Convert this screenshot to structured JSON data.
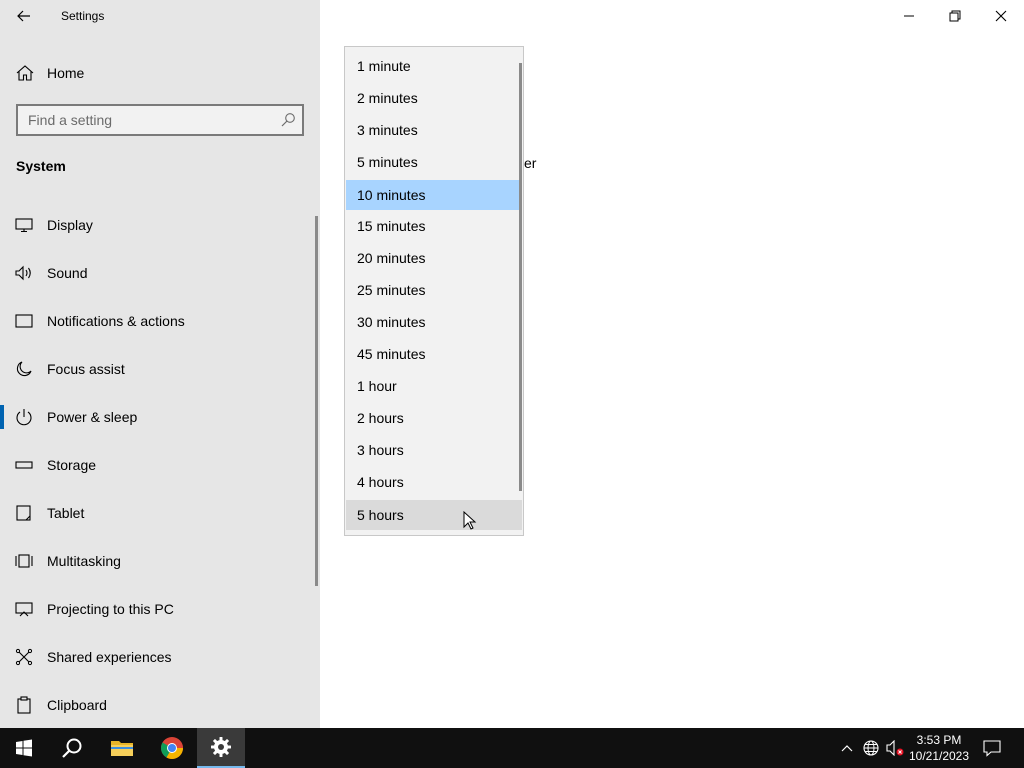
{
  "window": {
    "title": "Settings",
    "back_icon": "back-arrow-icon"
  },
  "sidebar": {
    "home_label": "Home",
    "search_placeholder": "Find a setting",
    "section_title": "System",
    "items": [
      {
        "label": "Display",
        "icon": "display-icon"
      },
      {
        "label": "Sound",
        "icon": "sound-icon"
      },
      {
        "label": "Notifications & actions",
        "icon": "notifications-icon"
      },
      {
        "label": "Focus assist",
        "icon": "focus-assist-icon"
      },
      {
        "label": "Power & sleep",
        "icon": "power-icon",
        "selected": true
      },
      {
        "label": "Storage",
        "icon": "storage-icon"
      },
      {
        "label": "Tablet",
        "icon": "tablet-icon"
      },
      {
        "label": "Multitasking",
        "icon": "multitasking-icon"
      },
      {
        "label": "Projecting to this PC",
        "icon": "projecting-icon"
      },
      {
        "label": "Shared experiences",
        "icon": "shared-experiences-icon"
      },
      {
        "label": "Clipboard",
        "icon": "clipboard-icon"
      }
    ]
  },
  "main": {
    "partial_text": "er"
  },
  "dropdown": {
    "selected": "10 minutes",
    "hovered": "5 hours",
    "options": [
      "1 minute",
      "2 minutes",
      "3 minutes",
      "5 minutes",
      "10 minutes",
      "15 minutes",
      "20 minutes",
      "25 minutes",
      "30 minutes",
      "45 minutes",
      "1 hour",
      "2 hours",
      "3 hours",
      "4 hours",
      "5 hours"
    ]
  },
  "taskbar": {
    "time": "3:53 PM",
    "date": "10/21/2023",
    "accent": "#76b9ed"
  },
  "colors": {
    "sidebar_bg": "#e6e6e6",
    "selection_accent": "#0063b1",
    "dropdown_selected": "#a8d4ff"
  }
}
